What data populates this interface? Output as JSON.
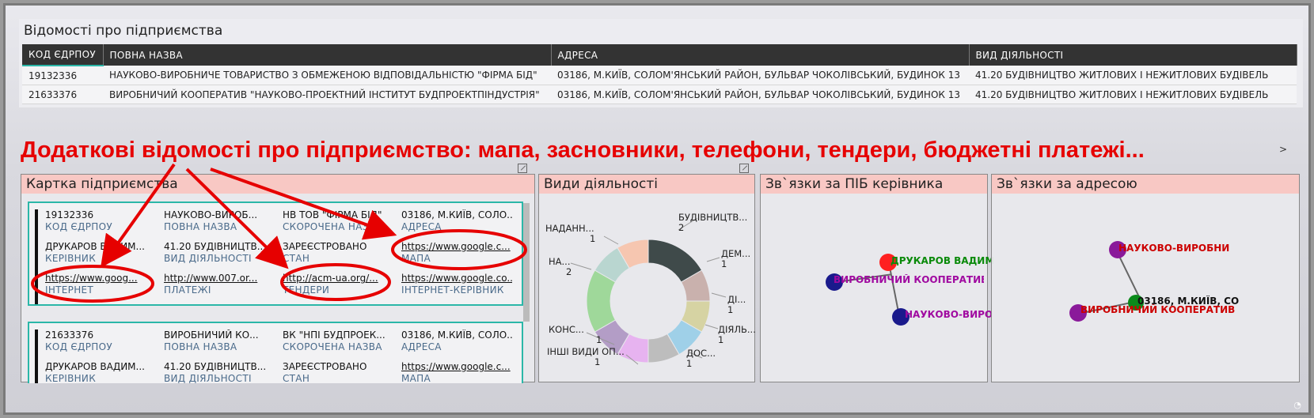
{
  "top": {
    "title": "Відомості про підприємства",
    "headers": [
      "КОД ЄДРПОУ",
      "ПОВНА НАЗВА",
      "АДРЕСА",
      "ВИД ДІЯЛЬНОСТІ"
    ],
    "rows": [
      [
        "19132336",
        "НАУКОВО-ВИРОБНИЧЕ ТОВАРИСТВО З ОБМЕЖЕНОЮ ВІДПОВІДАЛЬНІСТЮ \"ФІРМА БІД\"",
        "03186, М.КИЇВ, СОЛОМ'ЯНСЬКИЙ РАЙОН, БУЛЬВАР ЧОКОЛІВСЬКИЙ, БУДИНОК 13",
        "41.20 БУДІВНИЦТВО ЖИТЛОВИХ І НЕЖИТЛОВИХ БУДІВЕЛЬ"
      ],
      [
        "21633376",
        "ВИРОБНИЧИЙ КООПЕРАТИВ \"НАУКОВО-ПРОЕКТНИЙ ІНСТИТУТ БУДПРОЕКТПІНДУСТРІЯ\"",
        "03186, М.КИЇВ, СОЛОМ'ЯНСЬКИЙ РАЙОН, БУЛЬВАР ЧОКОЛІВСЬКИЙ, БУДИНОК 13",
        "41.20 БУДІВНИЦТВО ЖИТЛОВИХ І НЕЖИТЛОВИХ БУДІВЕЛЬ"
      ]
    ],
    "scroll_glyph": ">"
  },
  "annotation": "Додаткові відомості про підприємство: мапа, засновники, телефони, тендери, бюджетні платежі...",
  "card_panel": {
    "title": "Картка підприємства",
    "cards": [
      {
        "cells": [
          {
            "v": "19132336",
            "l": "КОД ЄДРПОУ"
          },
          {
            "v": "НАУКОВО-ВИРОБ...",
            "l": "ПОВНА НАЗВА"
          },
          {
            "v": "НВ ТОВ \"ФІРМА БІД\"",
            "l": "СКОРОЧЕНА НАЗВА"
          },
          {
            "v": "03186, М.КИЇВ, СОЛО...",
            "l": "АДРЕСА"
          },
          {
            "v": "ДРУКАРОВ ВАДИМ...",
            "l": "КЕРІВНИК"
          },
          {
            "v": "41.20 БУДІВНИЦТВ...",
            "l": "ВИД ДІЯЛЬНОСТІ"
          },
          {
            "v": "ЗАРЕЄСТРОВАНО",
            "l": "СТАН"
          },
          {
            "v": "https://www.google.c...",
            "l": "МАПА",
            "link": true
          },
          {
            "v": "https://www.goog...",
            "l": "ІНТЕРНЕТ",
            "link": true
          },
          {
            "v": "http://www.007.or...",
            "l": "ПЛАТЕЖІ",
            "link": true
          },
          {
            "v": "http://acm-ua.org/...",
            "l": "ТЕНДЕРИ",
            "link": true
          },
          {
            "v": "https://www.google.co...",
            "l": "ІНТЕРНЕТ-КЕРІВНИК",
            "link": true
          }
        ]
      },
      {
        "cells": [
          {
            "v": "21633376",
            "l": "КОД ЄДРПОУ"
          },
          {
            "v": "ВИРОБНИЧИЙ КО...",
            "l": "ПОВНА НАЗВА"
          },
          {
            "v": "ВК \"НПІ БУДПРОЕК...",
            "l": "СКОРОЧЕНА НАЗВА"
          },
          {
            "v": "03186, М.КИЇВ, СОЛО...",
            "l": "АДРЕСА"
          },
          {
            "v": "ДРУКАРОВ ВАДИМ...",
            "l": "КЕРІВНИК"
          },
          {
            "v": "41.20 БУДІВНИЦТВ...",
            "l": "ВИД ДІЯЛЬНОСТІ"
          },
          {
            "v": "ЗАРЕЄСТРОВАНО",
            "l": "СТАН"
          },
          {
            "v": "https://www.google.c...",
            "l": "МАПА",
            "link": true
          }
        ]
      }
    ]
  },
  "activities": {
    "title": "Види діяльності",
    "labels": [
      {
        "name": "БУДІВНИЦТВ...",
        "count": "2"
      },
      {
        "name": "ДЕМ...",
        "count": "1"
      },
      {
        "name": "ДІ...",
        "count": "1"
      },
      {
        "name": "ДІЯЛЬ...",
        "count": "1"
      },
      {
        "name": "ДОС...",
        "count": "1"
      },
      {
        "name": "ІНШІ ВИДИ ОП...",
        "count": "1"
      },
      {
        "name": "КОНС...",
        "count": "1"
      },
      {
        "name": "НА...",
        "count": "2"
      },
      {
        "name": "НАДАНН...",
        "count": "1"
      }
    ]
  },
  "chart_data": {
    "type": "pie",
    "categories": [
      "БУДІВНИЦТВ...",
      "ДЕМ...",
      "ДІ...",
      "ДІЯЛЬ...",
      "ДОС...",
      "ІНШІ ВИДИ ОП...",
      "КОНС...",
      "НА...",
      "НАДАНН...",
      "…"
    ],
    "values": [
      2,
      1,
      1,
      1,
      1,
      1,
      1,
      2,
      1,
      1
    ],
    "colors": [
      "#3f4a4a",
      "#c9b1ad",
      "#d6d3a3",
      "#9fd0e8",
      "#bdbdbd",
      "#e7b3f0",
      "#b39dc6",
      "#9fd89a",
      "#b9d6d0",
      "#f6c6b0",
      "#8fb5d8"
    ],
    "donut": true
  },
  "director_links": {
    "title": "Зв`язки за ПІБ керівника",
    "nodes": [
      {
        "label": "ДРУКАРОВ ВАДИМ",
        "color": "#ff2020",
        "label_color": "#0a8a0a"
      },
      {
        "label": "ВИРОБНИЧИЙ КООПЕРАТИВ '",
        "color": "#1a1a8c",
        "label_color": "#a00aa0"
      },
      {
        "label": "НАУКОВО-ВИРО",
        "color": "#1a1a8c",
        "label_color": "#a00aa0"
      }
    ]
  },
  "address_links": {
    "title": "Зв`язки за адресою",
    "nodes": [
      {
        "label": "НАУКОВО-ВИРОБНИ",
        "color": "#8a1a9a",
        "label_color": "#cc0000"
      },
      {
        "label": "03186, М.КИЇВ, СО",
        "color": "#0a8a1a",
        "label_color": "#111111"
      },
      {
        "label": "ВИРОБНИЧИЙ КООПЕРАТИВ",
        "color": "#8a1a9a",
        "label_color": "#cc0000"
      }
    ]
  }
}
